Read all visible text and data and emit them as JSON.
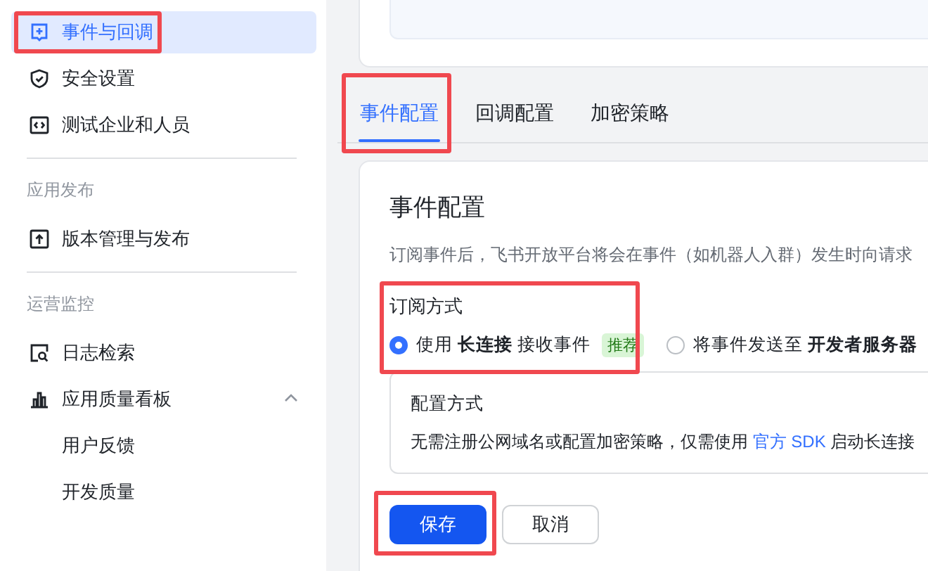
{
  "sidebar": {
    "sections": [
      {
        "items": [
          {
            "label": "事件与回调",
            "selected": true,
            "highlighted": true
          },
          {
            "label": "安全设置",
            "selected": false,
            "highlighted": false
          },
          {
            "label": "测试企业和人员",
            "selected": false,
            "highlighted": false
          }
        ]
      },
      {
        "header": "应用发布",
        "items": [
          {
            "label": "版本管理与发布",
            "selected": false,
            "highlighted": false
          }
        ]
      },
      {
        "header": "运营监控",
        "items": [
          {
            "label": "日志检索",
            "selected": false,
            "highlighted": false
          },
          {
            "label": "应用质量看板",
            "selected": false,
            "highlighted": false,
            "expanded": true,
            "children": [
              {
                "label": "用户反馈",
                "selected": false
              },
              {
                "label": "开发质量",
                "selected": false
              }
            ]
          }
        ]
      }
    ]
  },
  "tabs": [
    {
      "label": "事件配置",
      "selected": true,
      "highlighted": true
    },
    {
      "label": "回调配置",
      "selected": false,
      "highlighted": false
    },
    {
      "label": "加密策略",
      "selected": false,
      "highlighted": false
    }
  ],
  "event_config": {
    "title": "事件配置",
    "description": "订阅事件后，飞书开放平台将会在事件（如机器人入群）发生时向请求",
    "subscription": {
      "label": "订阅方式",
      "highlighted": true,
      "options": [
        {
          "label": "使用 **长连接** 接收事件",
          "badge": "推荐",
          "selected": true
        },
        {
          "label": "将事件发送至 **开发者服务器**",
          "selected": false
        }
      ]
    },
    "config_box": {
      "title": "配置方式",
      "text": "无需注册公网域名或配置加密策略，仅需使用",
      "link": "官方 SDK",
      "text_after": "启动长连接"
    },
    "buttons": [
      {
        "label": "保存",
        "kind": "primary",
        "highlighted": true
      },
      {
        "label": "取消",
        "kind": "secondary",
        "highlighted": false
      }
    ]
  }
}
